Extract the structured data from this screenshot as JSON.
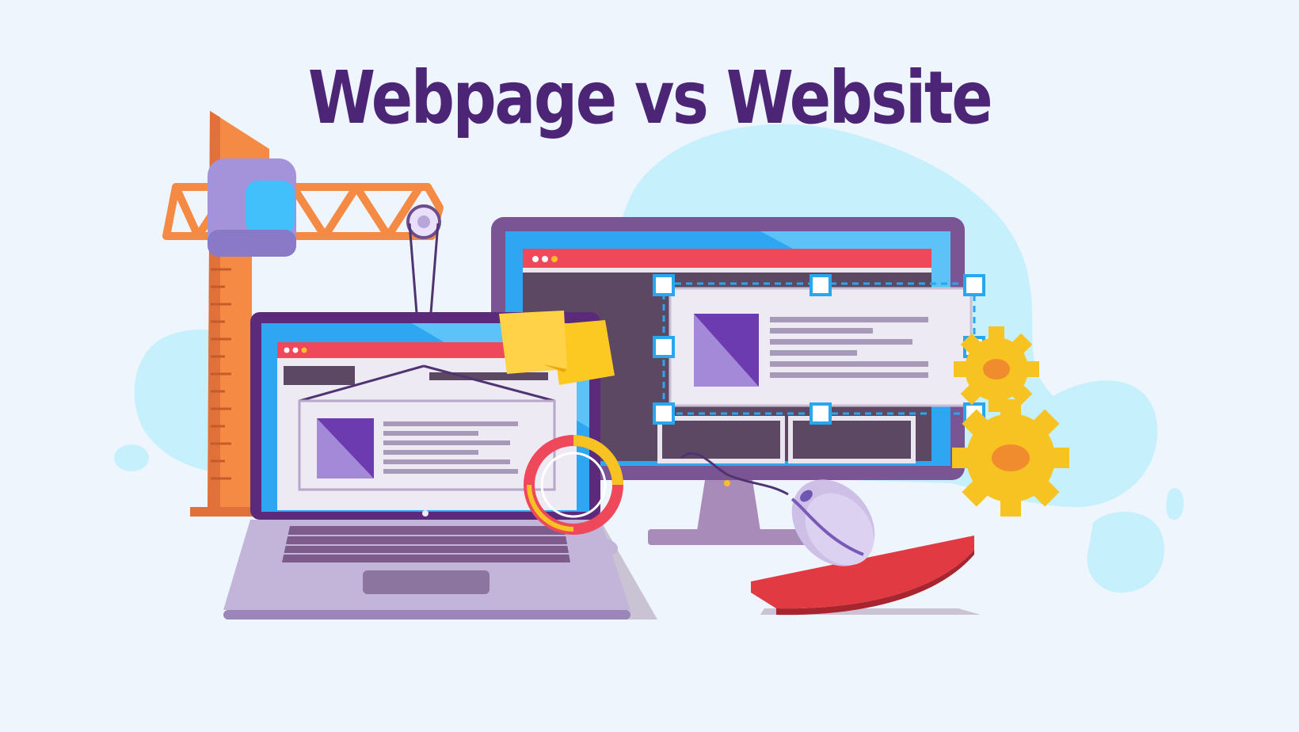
{
  "title": "Webpage vs Website",
  "colors": {
    "background": "#eef5fd",
    "title": "#4d2577",
    "blob": "#c6f0fb",
    "crane": "#f58a45",
    "screen_frame": "#7a5493",
    "screen_blue": "#2fa6f2",
    "browser_bar": "#f0485b",
    "selection": "#29a7ee",
    "gear": "#f7c323",
    "mouse_pad": "#e23a42",
    "sticky_note": "#ffd247"
  },
  "icons": {
    "crane": "tower-crane-icon",
    "laptop": "laptop-icon",
    "monitor": "desktop-monitor-icon",
    "gears": "gears-icon",
    "mouse": "computer-mouse-icon",
    "sticky_note": "sticky-note-icon",
    "tape": "measuring-tape-icon"
  }
}
